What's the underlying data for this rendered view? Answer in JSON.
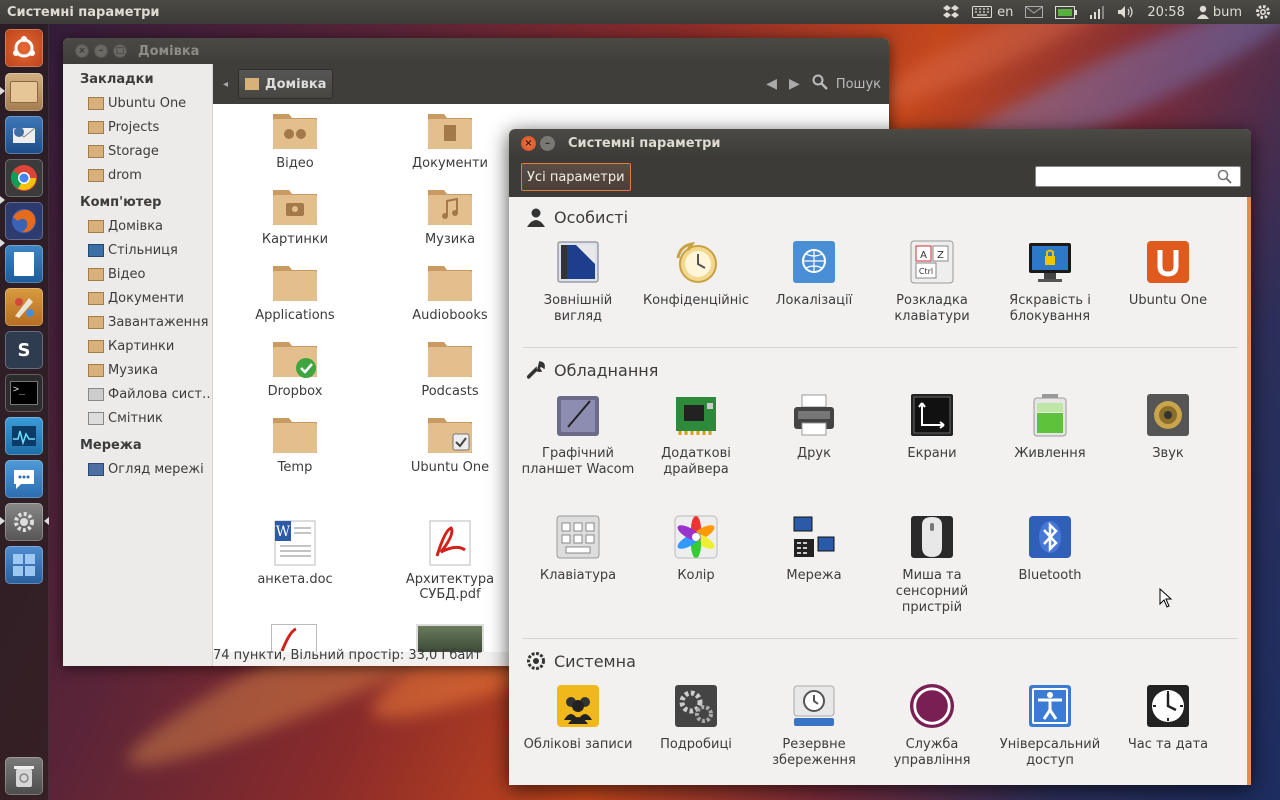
{
  "top_panel": {
    "title": "Системні параметри",
    "keyboard_layout": "en",
    "time": "20:58",
    "user": "bum",
    "icons": [
      "dropbox-icon",
      "keyboard-icon",
      "mail-icon",
      "battery-icon",
      "network-icon",
      "volume-icon",
      "user-icon",
      "gear-icon"
    ]
  },
  "launcher": {
    "items": [
      "ubuntu-logo-icon",
      "files-icon",
      "thunderbird-icon",
      "chrome-icon",
      "firefox-icon",
      "writer-icon",
      "paint-icon",
      "sublime-icon",
      "terminal-icon",
      "monitor-icon",
      "chat-icon",
      "system-settings-icon",
      "workspaces-icon",
      "trash-icon"
    ]
  },
  "nautilus": {
    "title": "Домівка",
    "path_button": "Домівка",
    "search_label": "Пошук",
    "sidebar": {
      "bookmarks_header": "Закладки",
      "bookmarks": [
        "Ubuntu One",
        "Projects",
        "Storage",
        "drom"
      ],
      "computer_header": "Комп'ютер",
      "computer": [
        "Домівка",
        "Стільниця",
        "Відео",
        "Документи",
        "Завантаження",
        "Картинки",
        "Музика",
        "Файлова сист…",
        "Смітник"
      ],
      "network_header": "Мережа",
      "network": [
        "Огляд мережі"
      ]
    },
    "files": [
      "Відео",
      "Документи",
      "Картинки",
      "Музика",
      "Applications",
      "Audiobooks",
      "Dropbox",
      "Podcasts",
      "Temp",
      "Ubuntu One",
      "анкета.doc",
      "Архитектура СУБД.pdf"
    ],
    "status": "74 пункти, Вільний простір: 33,0 Гбайт"
  },
  "settings": {
    "title": "Системні параметри",
    "all_settings": "Усі параметри",
    "search_placeholder": "",
    "personal": {
      "header": "Особисті",
      "items": [
        "Зовнішній вигляд",
        "Конфіденційніс",
        "Локалізації",
        "Розкладка клавіатури",
        "Яскравість і блокування",
        "Ubuntu One"
      ]
    },
    "hardware": {
      "header": "Обладнання",
      "items": [
        "Графічний планшет Wacom",
        "Додаткові драйвера",
        "Друк",
        "Екрани",
        "Живлення",
        "Звук",
        "Клавіатура",
        "Колір",
        "Мережа",
        "Миша та сенсорний пристрій",
        "Bluetooth"
      ]
    },
    "system": {
      "header": "Системна",
      "items": [
        "Облікові записи",
        "Подробиці",
        "Резервне збереження",
        "Служба управління",
        "Універсальний доступ",
        "Час та дата"
      ]
    },
    "colors": {
      "accent": "#e37a42",
      "panel": "#3c3b37"
    }
  }
}
